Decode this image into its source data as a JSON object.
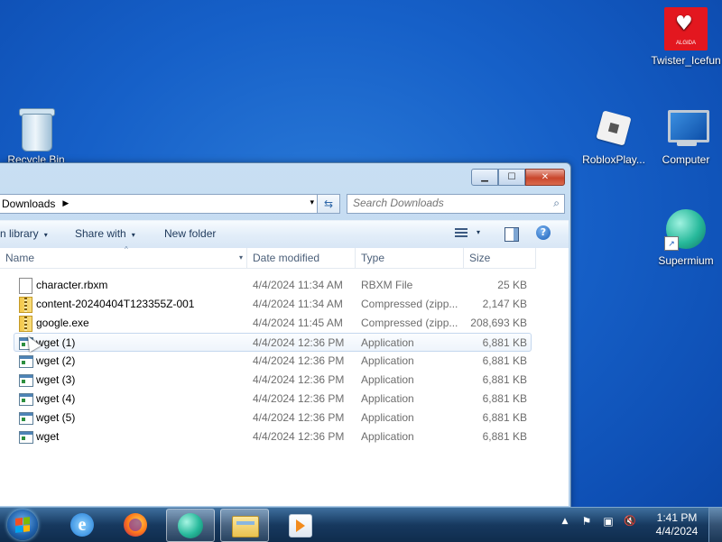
{
  "desktop": {
    "icons": [
      {
        "label": "Recycle Bin",
        "icon": "recycle-bin-icon"
      },
      {
        "label": "Twister_Icefun",
        "icon": "algida-icon",
        "brand_text": "ALGIDA"
      },
      {
        "label": "RobloxPlay...",
        "icon": "roblox-icon"
      },
      {
        "label": "Computer",
        "icon": "computer-icon"
      },
      {
        "label": "Supermium",
        "icon": "supermium-icon"
      }
    ]
  },
  "window": {
    "caption_buttons": {
      "minimize": "▁",
      "maximize": "☐",
      "close": "✕"
    },
    "address": {
      "path": "Downloads",
      "separator": "▶",
      "dropdown": "▾",
      "refresh": "⇆"
    },
    "search": {
      "placeholder": "Search Downloads",
      "icon": "search-icon"
    },
    "toolbar": {
      "include_library": "n library",
      "share_with": "Share with",
      "new_folder": "New folder",
      "dropdown_arrow": "▾",
      "help": "?"
    },
    "columns": [
      {
        "label": "Name"
      },
      {
        "label": "Date modified"
      },
      {
        "label": "Type"
      },
      {
        "label": "Size"
      }
    ],
    "sort_indicator": "^",
    "files": [
      {
        "name": "character.rbxm",
        "date": "4/4/2024 11:34 AM",
        "type": "RBXM File",
        "size": "25 KB",
        "icon": "doc"
      },
      {
        "name": "content-20240404T123355Z-001",
        "date": "4/4/2024 11:34 AM",
        "type": "Compressed (zipp...",
        "size": "2,147 KB",
        "icon": "zip"
      },
      {
        "name": "google.exe",
        "date": "4/4/2024 11:45 AM",
        "type": "Compressed (zipp...",
        "size": "208,693 KB",
        "icon": "zip"
      },
      {
        "name": "wget (1)",
        "date": "4/4/2024 12:36 PM",
        "type": "Application",
        "size": "6,881 KB",
        "icon": "app"
      },
      {
        "name": "wget (2)",
        "date": "4/4/2024 12:36 PM",
        "type": "Application",
        "size": "6,881 KB",
        "icon": "app"
      },
      {
        "name": "wget (3)",
        "date": "4/4/2024 12:36 PM",
        "type": "Application",
        "size": "6,881 KB",
        "icon": "app"
      },
      {
        "name": "wget (4)",
        "date": "4/4/2024 12:36 PM",
        "type": "Application",
        "size": "6,881 KB",
        "icon": "app"
      },
      {
        "name": "wget (5)",
        "date": "4/4/2024 12:36 PM",
        "type": "Application",
        "size": "6,881 KB",
        "icon": "app"
      },
      {
        "name": "wget",
        "date": "4/4/2024 12:36 PM",
        "type": "Application",
        "size": "6,881 KB",
        "icon": "app"
      }
    ]
  },
  "taskbar": {
    "buttons": [
      "internet-explorer",
      "firefox",
      "supermium",
      "windows-explorer",
      "media-player"
    ],
    "ie_glyph": "e",
    "tray": {
      "chevron": "▲",
      "flag": "⚑",
      "network": "▣",
      "volume": "🔇"
    },
    "clock": {
      "time": "1:41 PM",
      "date": "4/4/2024"
    }
  }
}
